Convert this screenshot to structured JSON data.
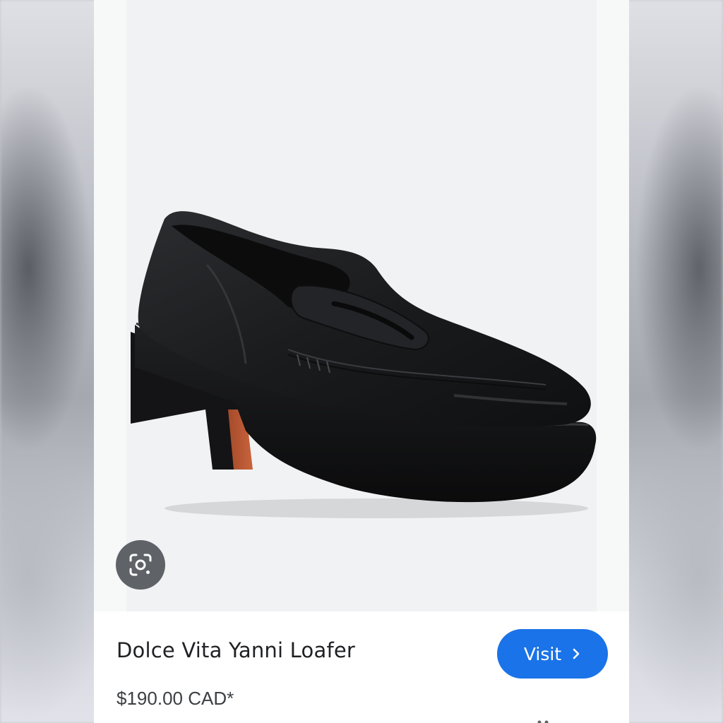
{
  "product": {
    "title": "Dolce Vita Yanni Loafer",
    "price": "$190.00 CAD*"
  },
  "actions": {
    "visit_label": "Visit",
    "visit_icon": "chevron-right-icon",
    "lens_icon": "google-lens-icon"
  },
  "colors": {
    "accent": "#1a73e8",
    "lens_button": "#5f6368",
    "image_background": "#f1f2f3"
  }
}
